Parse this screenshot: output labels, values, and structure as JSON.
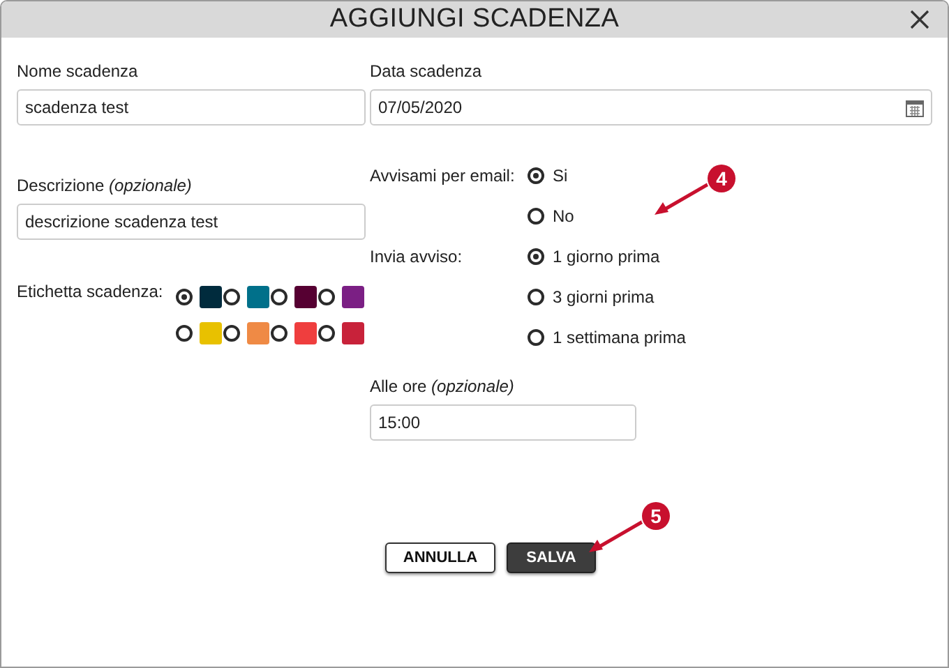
{
  "dialog": {
    "title": "AGGIUNGI SCADENZA"
  },
  "name_field": {
    "label": "Nome scadenza",
    "value": "scadenza test"
  },
  "date_field": {
    "label": "Data scadenza",
    "value": "07/05/2020"
  },
  "description_field": {
    "label": "Descrizione *(opzionale)*",
    "value": "descrizione scadenza test"
  },
  "label_colors": {
    "label": "Etichetta scadenza:",
    "options": [
      {
        "color": "#002b3d",
        "selected": true
      },
      {
        "color": "#00708a",
        "selected": false
      },
      {
        "color": "#560032",
        "selected": false
      },
      {
        "color": "#7b1f84",
        "selected": false
      },
      {
        "color": "#e8c100",
        "selected": false
      },
      {
        "color": "#ef8a45",
        "selected": false
      },
      {
        "color": "#ef3e3e",
        "selected": false
      },
      {
        "color": "#c8223a",
        "selected": false
      }
    ]
  },
  "email_alert": {
    "label": "Avvisami per email:",
    "options": [
      {
        "label": "Si",
        "selected": true
      },
      {
        "label": "No",
        "selected": false
      }
    ]
  },
  "send_alert": {
    "label": "Invia avviso:",
    "options": [
      {
        "label": "1 giorno prima",
        "selected": true
      },
      {
        "label": "3 giorni prima",
        "selected": false
      },
      {
        "label": "1 settimana prima",
        "selected": false
      }
    ]
  },
  "time_field": {
    "label": "Alle ore *(opzionale)*",
    "value": "15:00"
  },
  "buttons": [
    {
      "label": "ANNULLA",
      "kind": "secondary"
    },
    {
      "label": "SALVA",
      "kind": "primary"
    }
  ],
  "callouts": [
    {
      "number": "4"
    },
    {
      "number": "5"
    }
  ]
}
